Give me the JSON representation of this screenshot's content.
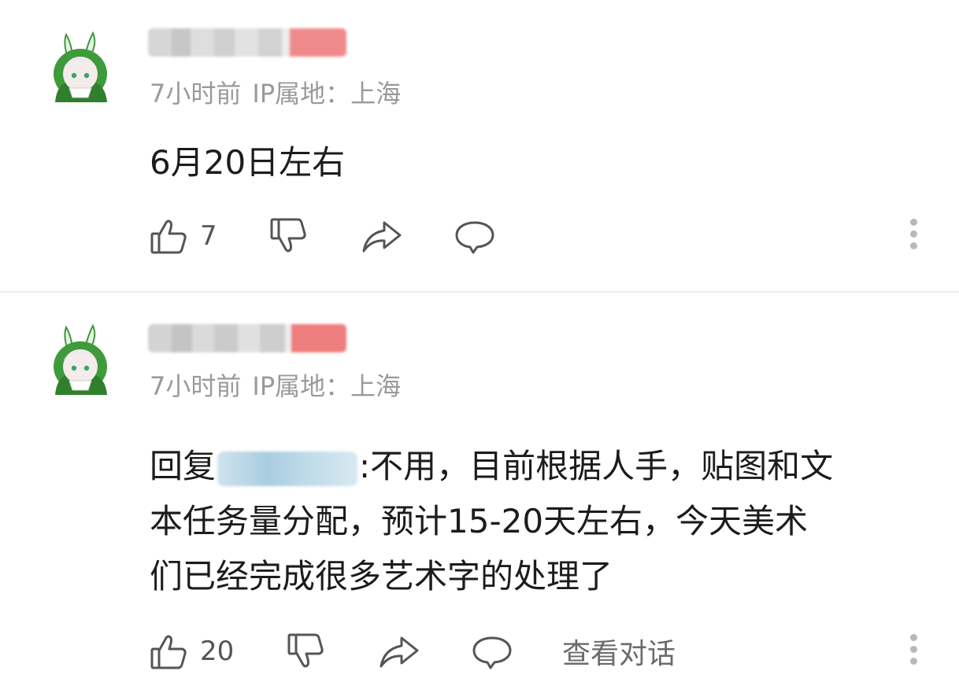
{
  "comments": [
    {
      "meta": {
        "time": "7小时前",
        "ip": "IP属地：上海"
      },
      "text": "6月20日左右",
      "likes": "7"
    },
    {
      "meta": {
        "time": "7小时前",
        "ip": "IP属地：上海"
      },
      "reply_prefix": "回复",
      "reply_text_line1": ":不用，目前根据人手，贴图和文",
      "reply_text_line2": "本任务量分配，预计15-20天左右，今天美术",
      "reply_text_line3": "们已经完成很多艺术字的处理了",
      "likes": "20",
      "view_thread": "查看对话"
    }
  ],
  "colors": {
    "avatar_hood": "#3f9a3b",
    "name_badge": "#f08080",
    "mention_blur": "#a9cde0"
  },
  "icons": [
    "avatar",
    "thumbs-up-icon",
    "thumbs-down-icon",
    "share-icon",
    "comment-icon",
    "more-vertical-icon"
  ]
}
